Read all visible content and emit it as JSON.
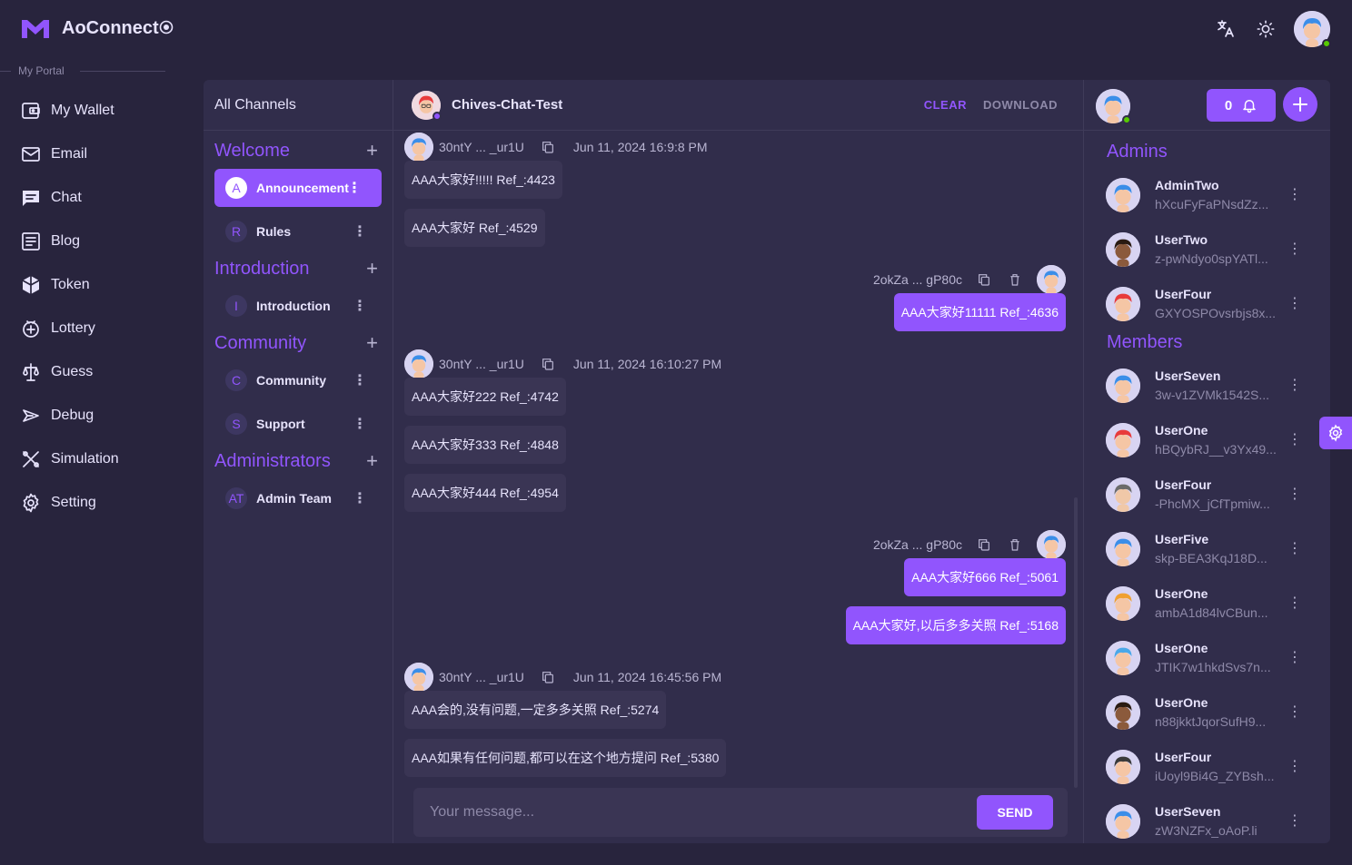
{
  "app": {
    "name": "AoConnect",
    "portal_label": "My Portal",
    "accent": "#9155fd"
  },
  "nav": [
    {
      "label": "My Wallet",
      "icon": "wallet-icon"
    },
    {
      "label": "Email",
      "icon": "email-icon"
    },
    {
      "label": "Chat",
      "icon": "chat-icon"
    },
    {
      "label": "Blog",
      "icon": "blog-icon"
    },
    {
      "label": "Token",
      "icon": "token-icon"
    },
    {
      "label": "Lottery",
      "icon": "lottery-icon"
    },
    {
      "label": "Guess",
      "icon": "guess-icon"
    },
    {
      "label": "Debug",
      "icon": "debug-icon"
    },
    {
      "label": "Simulation",
      "icon": "simulation-icon"
    },
    {
      "label": "Setting",
      "icon": "setting-icon"
    }
  ],
  "channels": {
    "header": "All Channels",
    "groups": [
      {
        "title": "Welcome",
        "items": [
          {
            "letter": "A",
            "label": "Announcement",
            "active": true
          },
          {
            "letter": "R",
            "label": "Rules"
          }
        ]
      },
      {
        "title": "Introduction",
        "items": [
          {
            "letter": "I",
            "label": "Introduction"
          }
        ]
      },
      {
        "title": "Community",
        "items": [
          {
            "letter": "C",
            "label": "Community"
          },
          {
            "letter": "S",
            "label": "Support"
          }
        ]
      },
      {
        "title": "Administrators",
        "items": [
          {
            "letter": "AT",
            "label": "Admin Team"
          }
        ]
      }
    ]
  },
  "chat": {
    "title": "Chives-Chat-Test",
    "clear_label": "CLEAR",
    "download_label": "DOWNLOAD",
    "messages": [
      {
        "sender": "30ntY ... _ur1U",
        "time": "Jun 11, 2024 16:9:8 PM",
        "dir": "in",
        "texts": [
          "AAA大家好!!!!! Ref_:4423",
          "AAA大家好 Ref_:4529"
        ]
      },
      {
        "sender": "2okZa ... gP80c",
        "dir": "out",
        "texts": [
          "AAA大家好11111 Ref_:4636"
        ]
      },
      {
        "sender": "30ntY ... _ur1U",
        "time": "Jun 11, 2024 16:10:27 PM",
        "dir": "in",
        "texts": [
          "AAA大家好222 Ref_:4742",
          "AAA大家好333 Ref_:4848",
          "AAA大家好444 Ref_:4954"
        ]
      },
      {
        "sender": "2okZa ... gP80c",
        "dir": "out",
        "texts": [
          "AAA大家好666 Ref_:5061",
          "AAA大家好,以后多多关照 Ref_:5168"
        ]
      },
      {
        "sender": "30ntY ... _ur1U",
        "time": "Jun 11, 2024 16:45:56 PM",
        "dir": "in",
        "texts": [
          "AAA会的,没有问题,一定多多关照 Ref_:5274",
          "AAA如果有任何问题,都可以在这个地方提问 Ref_:5380"
        ]
      }
    ],
    "input_placeholder": "Your message...",
    "send_label": "SEND"
  },
  "members_panel": {
    "notification_count": "0",
    "admins_title": "Admins",
    "members_title": "Members",
    "admins": [
      {
        "name": "AdminTwo",
        "addr": "hXcuFyFaPNsdZz...",
        "skin": "#f5c6a5",
        "hair": "#3b8ee8"
      },
      {
        "name": "UserTwo",
        "addr": "z-pwNdyo0spYATl...",
        "skin": "#8b5a3c",
        "hair": "#2a1b12"
      },
      {
        "name": "UserFour",
        "addr": "GXYOSPOvsrbjs8x...",
        "skin": "#f5c6a5",
        "hair": "#e83b3b"
      }
    ],
    "members": [
      {
        "name": "UserSeven",
        "addr": "3w-v1ZVMk1542S...",
        "skin": "#f5c6a5",
        "hair": "#3b8ee8"
      },
      {
        "name": "UserOne",
        "addr": "hBQybRJ__v3Yx49...",
        "skin": "#f5c6a5",
        "hair": "#e83b3b"
      },
      {
        "name": "UserFour",
        "addr": "-PhcMX_jCfTpmiw...",
        "skin": "#f0c8a8",
        "hair": "#6b6b6b"
      },
      {
        "name": "UserFive",
        "addr": "skp-BEA3KqJ18D...",
        "skin": "#f5c6a5",
        "hair": "#3b8ee8"
      },
      {
        "name": "UserOne",
        "addr": "ambA1d84lvCBun...",
        "skin": "#f5c6a5",
        "hair": "#f0a030"
      },
      {
        "name": "UserOne",
        "addr": "JTIK7w1hkdSvs7n...",
        "skin": "#f5c6a5",
        "hair": "#4aa8e8"
      },
      {
        "name": "UserOne",
        "addr": "n88jkktJqorSufH9...",
        "skin": "#8b5a3c",
        "hair": "#2a1b12"
      },
      {
        "name": "UserFour",
        "addr": "iUoyl9Bi4G_ZYBsh...",
        "skin": "#f5c6a5",
        "hair": "#3a3a3a"
      },
      {
        "name": "UserSeven",
        "addr": "zW3NZFx_oAoP.li",
        "skin": "#f5c6a5",
        "hair": "#3b8ee8"
      }
    ]
  }
}
